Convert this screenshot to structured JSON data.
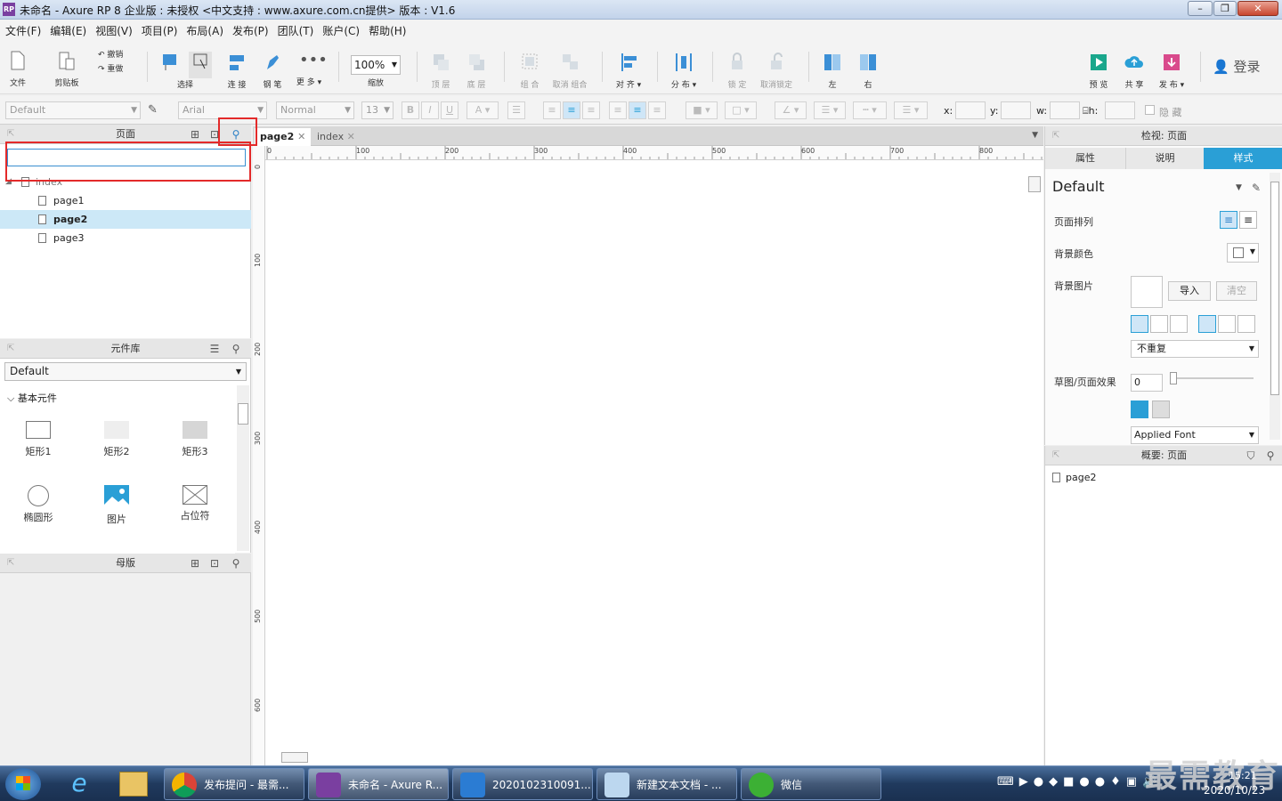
{
  "window": {
    "title": "未命名 - Axure RP 8 企业版 : 未授权      <中文支持 : www.axure.com.cn提供> 版本 : V1.6",
    "app_icon": "RP"
  },
  "menu": [
    "文件(F)",
    "编辑(E)",
    "视图(V)",
    "项目(P)",
    "布局(A)",
    "发布(P)",
    "团队(T)",
    "账户(C)",
    "帮助(H)"
  ],
  "toolbar": {
    "file": "文件",
    "clipboard": "剪贴板",
    "undo": "撤销",
    "redo": "重做",
    "select": "选择",
    "connect": "连 接",
    "pen": "钢 笔",
    "more": "更 多 ▾",
    "zoom_value": "100%",
    "zoom": "缩放",
    "top": "顶 层",
    "bottom": "底 层",
    "group": "组 合",
    "ungroup": "取消 组合",
    "align": "对 齐 ▾",
    "distribute": "分 布 ▾",
    "lock": "锁 定",
    "unlock": "取消锁定",
    "left": "左",
    "right": "右",
    "preview": "预 览",
    "share": "共 享",
    "publish": "发 布 ▾",
    "login": "登录"
  },
  "format": {
    "style": "Default",
    "font": "Arial",
    "weight": "Normal",
    "size": "13",
    "x": "x:",
    "y": "y:",
    "w": "w:",
    "h": "h:",
    "hide": "隐 藏"
  },
  "pages_panel": {
    "title": "页面",
    "search_placeholder": "",
    "items": [
      "index",
      "page1",
      "page2",
      "page3"
    ],
    "selected": "page2"
  },
  "library_panel": {
    "title": "元件库",
    "library": "Default",
    "category": "基本元件",
    "widgets": [
      "矩形1",
      "矩形2",
      "矩形3",
      "椭圆形",
      "图片",
      "占位符"
    ]
  },
  "masters_panel": {
    "title": "母版"
  },
  "tabs": [
    {
      "label": "page2",
      "active": true
    },
    {
      "label": "index",
      "active": false
    }
  ],
  "ruler": {
    "h_marks": [
      "0",
      "100",
      "200",
      "300",
      "400",
      "500",
      "600",
      "700",
      "800"
    ],
    "v_marks": [
      "0",
      "100",
      "200",
      "300",
      "400",
      "500",
      "600"
    ]
  },
  "inspector": {
    "title": "检视: 页面",
    "tabs": [
      "属性",
      "说明",
      "样式"
    ],
    "active_tab": "样式",
    "style_value": "Default",
    "page_align": "页面排列",
    "bg_color": "背景颜色",
    "bg_image": "背景图片",
    "import": "导入",
    "clear": "清空",
    "repeat": "不重复",
    "sketch": "草图/页面效果",
    "sketch_value": "0",
    "font": "Applied Font"
  },
  "outline": {
    "title": "概要: 页面",
    "item": "page2"
  },
  "taskbar": {
    "items": [
      "发布提问 - 最需...",
      "未命名 - Axure R...",
      "2020102310091...",
      "新建文本文档 - ...",
      "微信"
    ],
    "time": "15:21",
    "date": "2020/10/23",
    "watermark": "最需教育"
  },
  "colors": {
    "accent": "#2a9fd6",
    "selected_row": "#cce8f7",
    "highlight": "#e32a2a"
  }
}
